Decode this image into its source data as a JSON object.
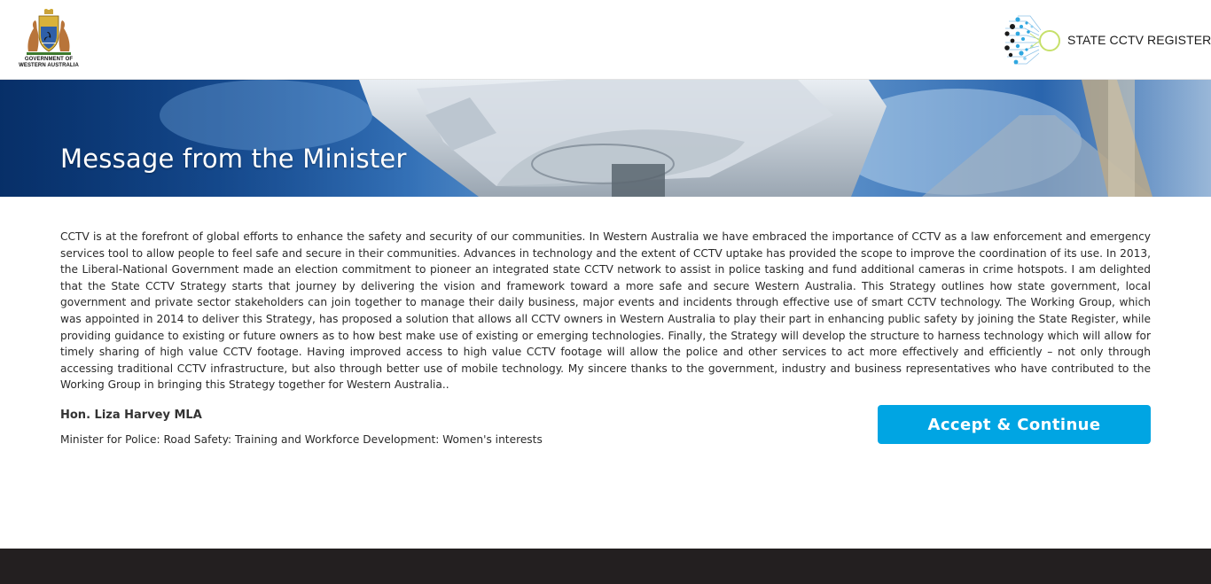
{
  "header": {
    "gov_logo": {
      "icon": "wa-coat-of-arms-icon",
      "line1": "GOVERNMENT OF",
      "line2": "WESTERN AUSTRALIA"
    },
    "cctv_logo": {
      "icon": "cctv-network-icon",
      "title": "STATE CCTV REGISTER"
    }
  },
  "banner": {
    "title": "Message from the Minister"
  },
  "message": {
    "body": "CCTV is at the forefront of global efforts to enhance the safety and security of our communities. In Western Australia we have embraced the importance of CCTV as a law enforcement and emergency services tool to allow people to feel safe and secure in their communities. Advances in technology and the extent of CCTV uptake has provided the scope to improve the coordination of its use. In 2013, the Liberal-National Government made an election commitment to pioneer an integrated state CCTV network to assist in police tasking and fund additional cameras in crime hotspots. I am delighted that the State CCTV Strategy starts that journey by delivering the vision and framework toward a more safe and secure Western Australia. This Strategy outlines how state government, local government and private sector stakeholders can join together to manage their daily business, major events and incidents through effective use of smart CCTV technology. The Working Group, which was appointed in 2014 to deliver this Strategy, has proposed a solution that allows all CCTV owners in Western Australia to play their part in enhancing public safety by joining the State Register, while providing guidance to existing or future owners as to how best make use of existing or emerging technologies. Finally, the Strategy will develop the structure to harness technology which will allow for timely sharing of high value CCTV footage. Having improved access to high value CCTV footage will allow the police and other services to act more effectively and efficiently – not only through accessing traditional CCTV infrastructure, but also through better use of mobile technology. My sincere thanks to the government, industry and business representatives who have contributed to the Working Group in bringing this Strategy together for Western Australia..",
    "signatory_name": "Hon. Liza Harvey MLA",
    "signatory_role": "Minister for Police: Road Safety: Training and Workforce Development: Women's interests"
  },
  "actions": {
    "accept_label": "Accept & Continue"
  },
  "colors": {
    "accent": "#00a5e3",
    "footer": "#231f20",
    "banner_text": "#ffffff"
  }
}
